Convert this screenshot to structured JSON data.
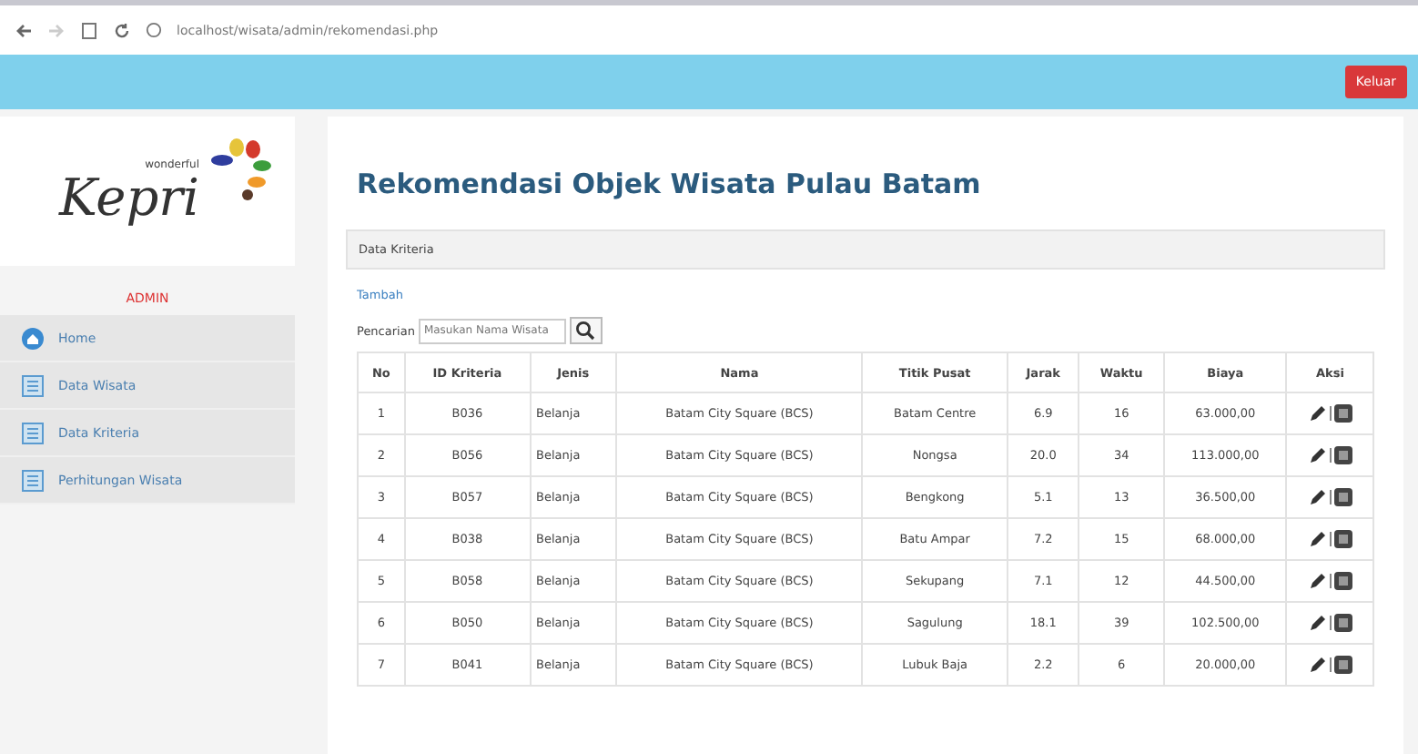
{
  "browser": {
    "address": "localhost/wisata/admin/rekomendasi.php"
  },
  "header": {
    "logout_button": "Keluar"
  },
  "sidebar": {
    "logo": {
      "small_text": "wonderful",
      "main_text": "Kepri"
    },
    "role": "ADMIN",
    "items": [
      {
        "label": "Home",
        "kind": "home",
        "selected": false
      },
      {
        "label": "Data Wisata",
        "kind": "list",
        "selected": false
      },
      {
        "label": "Data Kriteria",
        "kind": "list",
        "selected": false
      },
      {
        "label": "Perhitungan Wisata",
        "kind": "list",
        "selected": false
      }
    ]
  },
  "page": {
    "title": "Rekomendasi Objek Wisata Pulau Batam",
    "panel_heading": "Data Kriteria",
    "link": "Tambah",
    "search": {
      "label": "Pencarian",
      "placeholder": "Masukan Nama Wisata"
    }
  },
  "table": {
    "columns": [
      "No",
      "ID Kriteria",
      "Jenis",
      "Nama",
      "Titik Pusat",
      "Jarak",
      "Waktu",
      "Biaya",
      "Aksi"
    ],
    "rows": [
      [
        "1",
        "B036",
        "Belanja",
        "Batam City Square (BCS)",
        "Batam Centre",
        "6.9",
        "16",
        "63.000,00"
      ],
      [
        "2",
        "B056",
        "Belanja",
        "Batam City Square (BCS)",
        "Nongsa",
        "20.0",
        "34",
        "113.000,00"
      ],
      [
        "3",
        "B057",
        "Belanja",
        "Batam City Square (BCS)",
        "Bengkong",
        "5.1",
        "13",
        "36.500,00"
      ],
      [
        "4",
        "B038",
        "Belanja",
        "Batam City Square (BCS)",
        "Batu Ampar",
        "7.2",
        "15",
        "68.000,00"
      ],
      [
        "5",
        "B058",
        "Belanja",
        "Batam City Square (BCS)",
        "Sekupang",
        "7.1",
        "12",
        "44.500,00"
      ],
      [
        "6",
        "B050",
        "Belanja",
        "Batam City Square (BCS)",
        "Sagulung",
        "18.1",
        "39",
        "102.500,00"
      ],
      [
        "7",
        "B041",
        "Belanja",
        "Batam City Square (BCS)",
        "Lubuk Baja",
        "2.2",
        "6",
        "20.000,00"
      ]
    ]
  }
}
